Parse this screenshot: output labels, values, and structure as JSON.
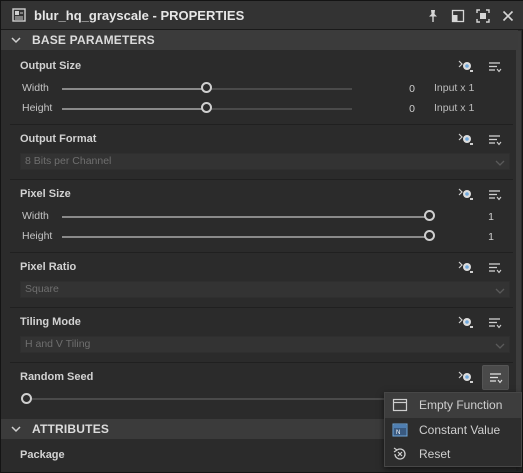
{
  "window": {
    "title": "blur_hq_grayscale - PROPERTIES",
    "icons": [
      "app-icon",
      "pin-icon",
      "window-icon",
      "maximize-icon",
      "close-icon"
    ]
  },
  "sections": {
    "base": "BASE PARAMETERS",
    "attributes": "ATTRIBUTES"
  },
  "params": {
    "output_size": {
      "label": "Output Size",
      "width_label": "Width",
      "width_value": "0",
      "width_suffix": "Input x 1",
      "height_label": "Height",
      "height_value": "0",
      "height_suffix": "Input x 1"
    },
    "output_format": {
      "label": "Output Format",
      "value": "8 Bits per Channel"
    },
    "pixel_size": {
      "label": "Pixel Size",
      "width_label": "Width",
      "width_value": "1",
      "height_label": "Height",
      "height_value": "1"
    },
    "pixel_ratio": {
      "label": "Pixel Ratio",
      "value": "Square"
    },
    "tiling_mode": {
      "label": "Tiling Mode",
      "value": "H and V Tiling"
    },
    "random_seed": {
      "label": "Random Seed"
    }
  },
  "attributes": {
    "package_label": "Package"
  },
  "context_menu": {
    "items": [
      {
        "label": "Empty Function",
        "icon": "empty-function-icon",
        "highlighted": true
      },
      {
        "label": "Constant Value",
        "icon": "constant-value-icon",
        "highlighted": false
      },
      {
        "label": "Reset",
        "icon": "reset-icon",
        "highlighted": false
      }
    ]
  },
  "colors": {
    "panel_bg": "#2b2b2b",
    "header_bg": "#3b3b3b",
    "title_bg": "#333333",
    "accent_icon": "#6fa8dc"
  }
}
